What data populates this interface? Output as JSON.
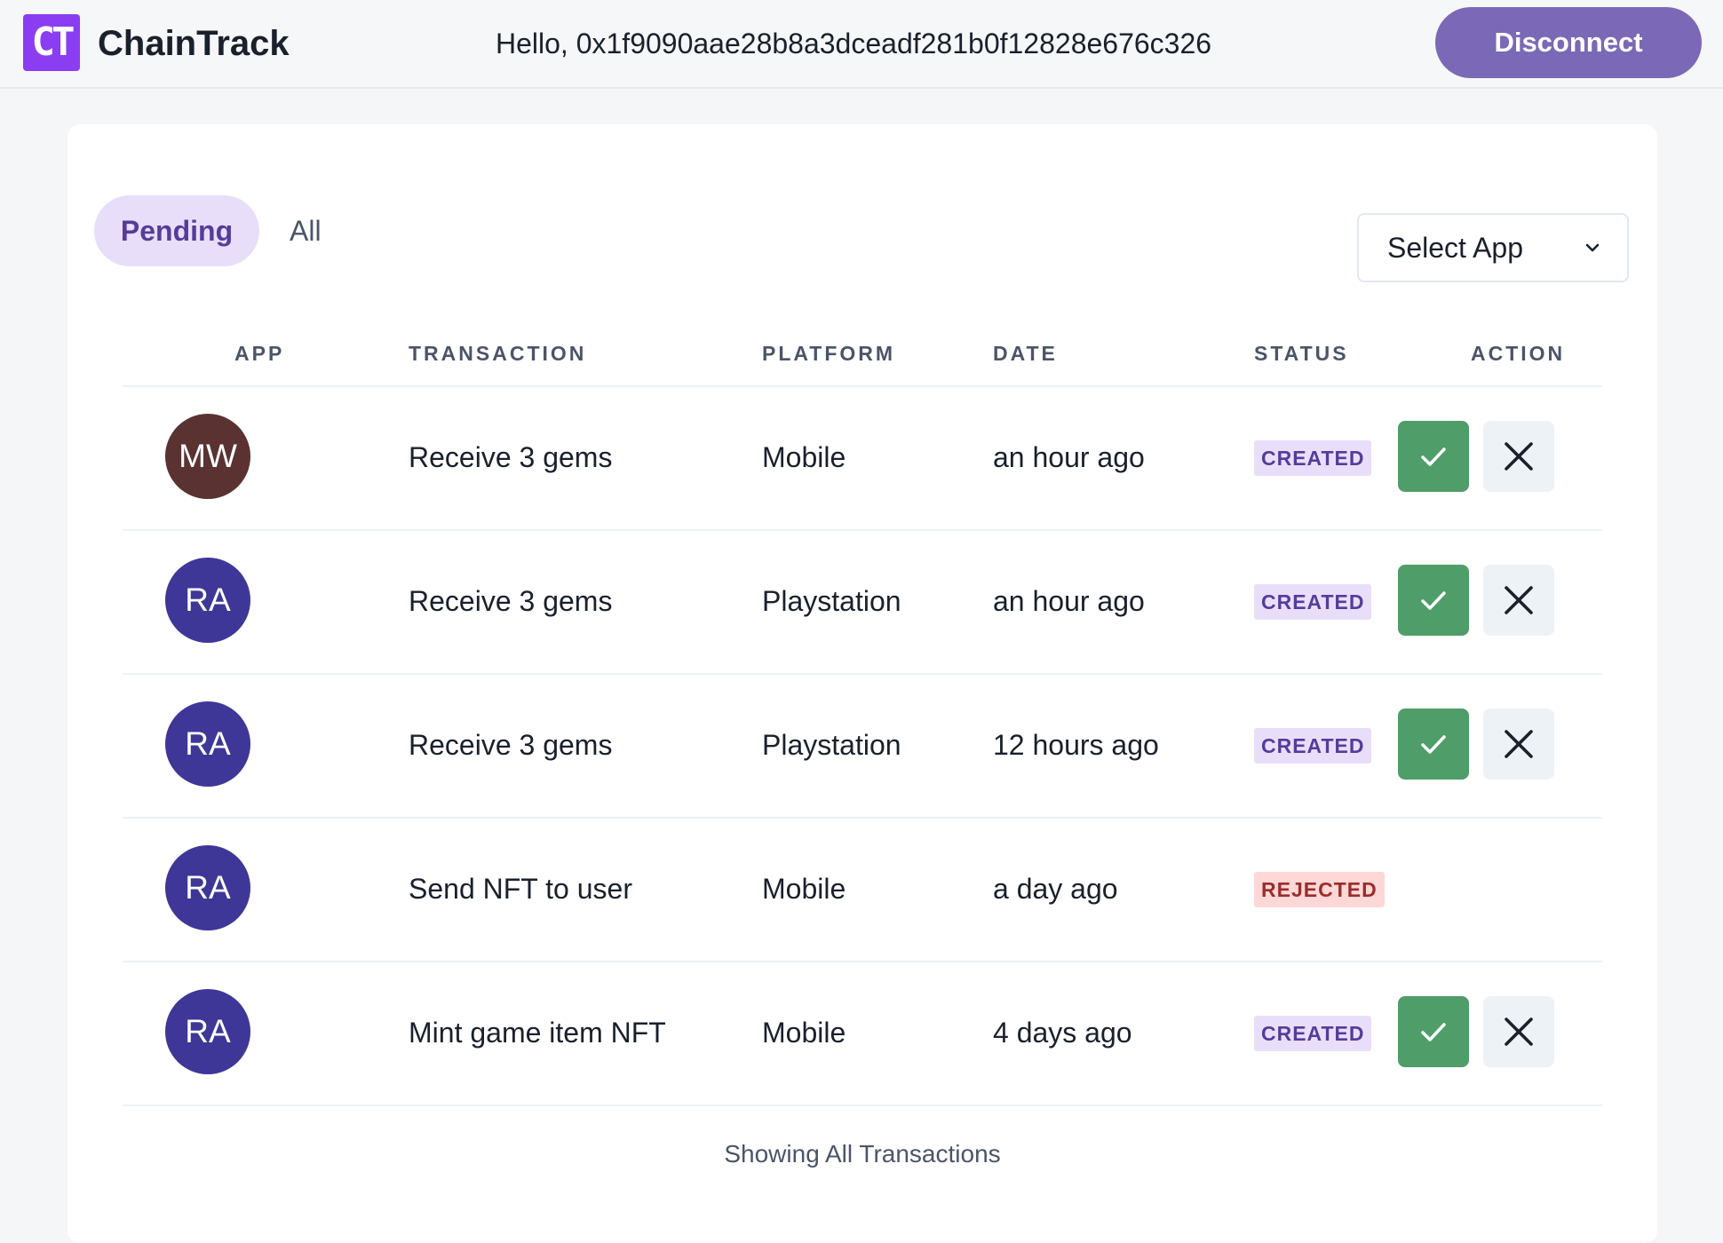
{
  "header": {
    "logo_text": "CT",
    "brand": "ChainTrack",
    "greeting": "Hello, 0x1f9090aae28b8a3dceadf281b0f12828e676c326",
    "disconnect_label": "Disconnect"
  },
  "filters": {
    "tabs": [
      {
        "label": "Pending",
        "active": true
      },
      {
        "label": "All",
        "active": false
      }
    ],
    "select_app": "Select App"
  },
  "table": {
    "columns": [
      "APP",
      "TRANSACTION",
      "PLATFORM",
      "DATE",
      "STATUS",
      "ACTION"
    ],
    "rows": [
      {
        "initials": "MW",
        "avatar_color": "#5a3232",
        "transaction": "Receive 3 gems",
        "platform": "Mobile",
        "date": "an hour ago",
        "status": "CREATED",
        "actions": true
      },
      {
        "initials": "RA",
        "avatar_color": "#3f3797",
        "transaction": "Receive 3 gems",
        "platform": "Playstation",
        "date": "an hour ago",
        "status": "CREATED",
        "actions": true
      },
      {
        "initials": "RA",
        "avatar_color": "#3f3797",
        "transaction": "Receive 3 gems",
        "platform": "Playstation",
        "date": "12 hours ago",
        "status": "CREATED",
        "actions": true
      },
      {
        "initials": "RA",
        "avatar_color": "#3f3797",
        "transaction": "Send NFT to user",
        "platform": "Mobile",
        "date": "a day ago",
        "status": "REJECTED",
        "actions": false
      },
      {
        "initials": "RA",
        "avatar_color": "#3f3797",
        "transaction": "Mint game item NFT",
        "platform": "Mobile",
        "date": "4 days ago",
        "status": "CREATED",
        "actions": true
      }
    ]
  },
  "footer": {
    "text": "Showing All Transactions"
  },
  "colors": {
    "accent": "#7b68b6",
    "created_bg": "#e9defa",
    "created_fg": "#553c9a",
    "rejected_bg": "#fed7d7",
    "rejected_fg": "#9b2c2c",
    "approve_green": "#4f9d69"
  },
  "icons": {
    "approve": "check-icon",
    "reject": "close-icon",
    "select": "chevron-down-icon"
  }
}
